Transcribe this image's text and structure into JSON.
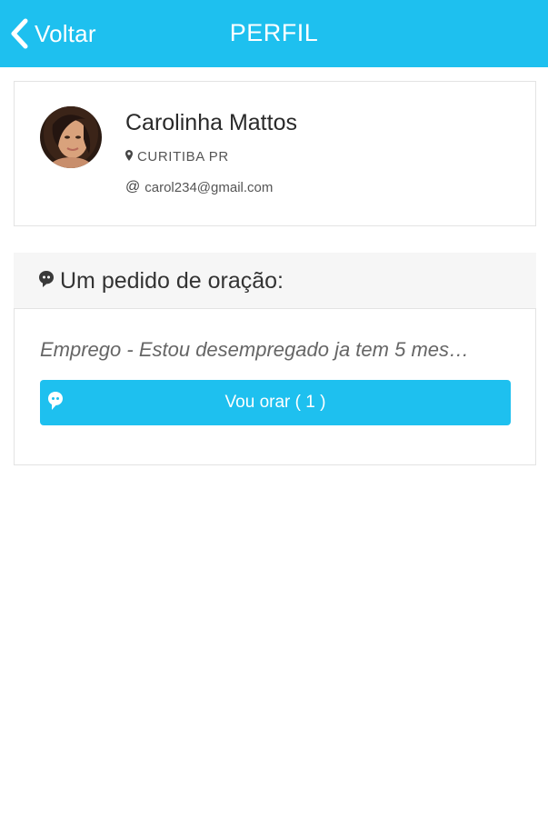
{
  "header": {
    "back_label": "Voltar",
    "title": "PERFIL"
  },
  "profile": {
    "name": "Carolinha Mattos",
    "location": "CURITIBA PR",
    "email": "carol234@gmail.com",
    "at_symbol": "@"
  },
  "prayer": {
    "section_title": "Um pedido de oração:",
    "request_text": "Emprego - Estou desempregado ja tem 5 mes…",
    "button_label": "Vou orar ( 1 )"
  },
  "colors": {
    "accent": "#1ec0ef",
    "header_bg": "#f6f6f6"
  },
  "icons": {
    "back": "chevron-left-icon",
    "location": "map-pin-icon",
    "email": "at-icon",
    "section": "chat-bubble-icon",
    "button": "chat-bubble-icon"
  }
}
